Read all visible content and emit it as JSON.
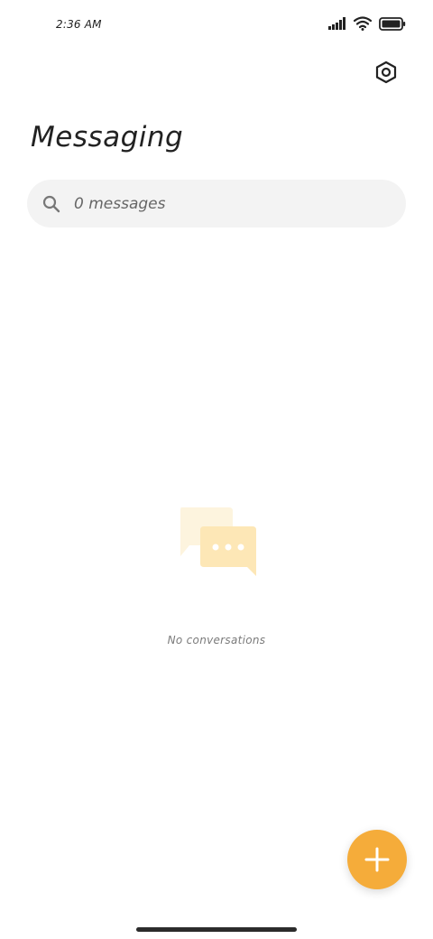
{
  "status_bar": {
    "time": "2:36 AM"
  },
  "header": {
    "title": "Messaging"
  },
  "search": {
    "placeholder": "0 messages"
  },
  "empty_state": {
    "text": "No conversations"
  },
  "icons": {
    "settings": "settings-hexagon-icon",
    "search": "search-icon",
    "empty": "chat-bubbles-icon",
    "fab": "plus-icon"
  },
  "colors": {
    "accent": "#f5ac3a",
    "illustration_back": "#fdf4de",
    "illustration_front": "#fde7b6"
  }
}
